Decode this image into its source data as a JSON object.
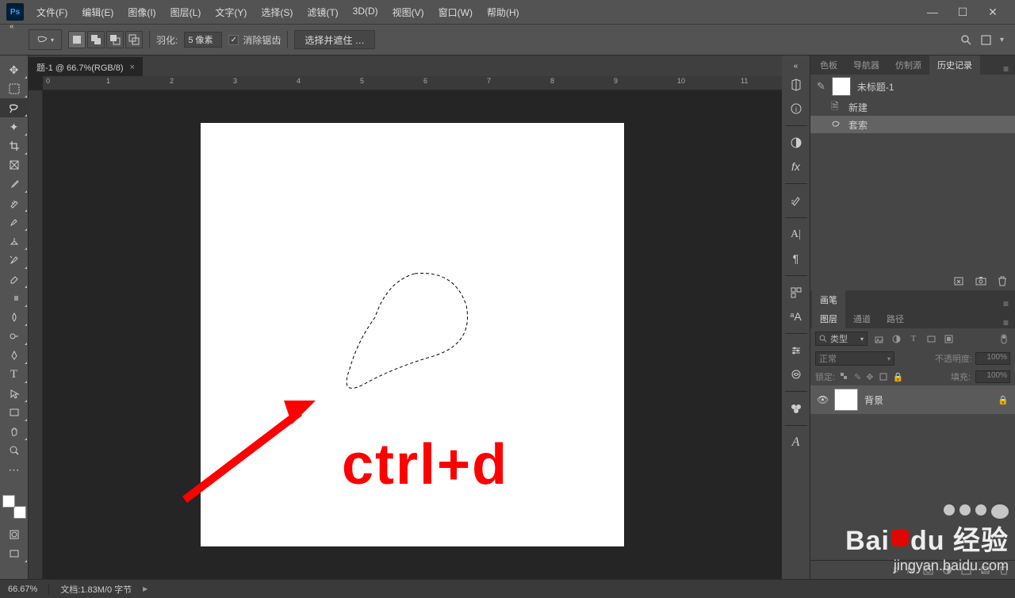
{
  "menu": [
    "文件(F)",
    "编辑(E)",
    "图像(I)",
    "图层(L)",
    "文字(Y)",
    "选择(S)",
    "滤镜(T)",
    "3D(D)",
    "视图(V)",
    "窗口(W)",
    "帮助(H)"
  ],
  "options": {
    "feather_label": "羽化:",
    "feather_value": "5 像素",
    "antialias": "消除锯齿",
    "select_mask": "选择并遮住 …"
  },
  "doc": {
    "tab": "题-1 @ 66.7%(RGB/8)",
    "overlay_text": "ctrl+d"
  },
  "panels": {
    "tabs_top": [
      "色板",
      "导航器",
      "仿制源",
      "历史记录"
    ],
    "history_doc": "未标题-1",
    "history_items": [
      {
        "icon": "file",
        "label": "新建"
      },
      {
        "icon": "lasso",
        "label": "套索"
      }
    ],
    "brush_tab": "画笔",
    "layers_tabs": [
      "图层",
      "通道",
      "路径"
    ],
    "filter_label": "类型",
    "blend_mode": "正常",
    "opacity_label": "不透明度:",
    "opacity_value": "100%",
    "lock_label": "锁定:",
    "fill_label": "填充:",
    "fill_value": "100%",
    "layer_name": "背景"
  },
  "status": {
    "zoom": "66.67%",
    "doc_size": "文档:1.83M/0 字节"
  },
  "watermark": {
    "line1a": "Bai",
    "line1b": "du",
    "line1c": "经验",
    "line2": "jingyan.baidu.com"
  }
}
